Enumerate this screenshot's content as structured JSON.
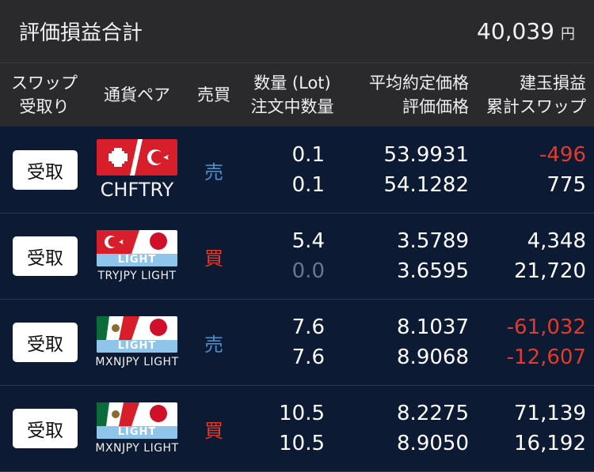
{
  "summary": {
    "label": "評価損益合計",
    "value": "40,039",
    "unit": "円"
  },
  "header": {
    "swap_line1": "スワップ",
    "swap_line2": "受取り",
    "pair": "通貨ペア",
    "side": "売買",
    "qty_line1": "数量 (Lot)",
    "qty_line2": "注文中数量",
    "price_line1": "平均約定価格",
    "price_line2": "評価価格",
    "pl_line1": "建玉損益",
    "pl_line2": "累計スワップ"
  },
  "rows": [
    {
      "button": "受取",
      "pair": "CHFTRY",
      "flag": "chf-try",
      "side": "売",
      "side_type": "sell",
      "qty": "0.1",
      "order_qty": "0.1",
      "avg_price": "53.9931",
      "eval_price": "54.1282",
      "pl": "-496",
      "swap": "775"
    },
    {
      "button": "受取",
      "pair": "TRYJPY LIGHT",
      "flag": "try-jpy-light",
      "side": "買",
      "side_type": "buy",
      "qty": "5.4",
      "order_qty": "0.0",
      "avg_price": "3.5789",
      "eval_price": "3.6595",
      "pl": "4,348",
      "swap": "21,720"
    },
    {
      "button": "受取",
      "pair": "MXNJPY LIGHT",
      "flag": "mxn-jpy-light",
      "side": "売",
      "side_type": "sell",
      "qty": "7.6",
      "order_qty": "7.6",
      "avg_price": "8.1037",
      "eval_price": "8.9068",
      "pl": "-61,032",
      "swap": "-12,607"
    },
    {
      "button": "受取",
      "pair": "MXNJPY LIGHT",
      "flag": "mxn-jpy-light",
      "side": "買",
      "side_type": "buy",
      "qty": "10.5",
      "order_qty": "10.5",
      "avg_price": "8.2275",
      "eval_price": "8.9050",
      "pl": "71,139",
      "swap": "16,192"
    }
  ],
  "colors": {
    "sell": "#4f8cc9",
    "buy": "#e23a2b",
    "negative": "#e23a2b",
    "background": "#0c1a33"
  },
  "light_badge": "LIGHT"
}
